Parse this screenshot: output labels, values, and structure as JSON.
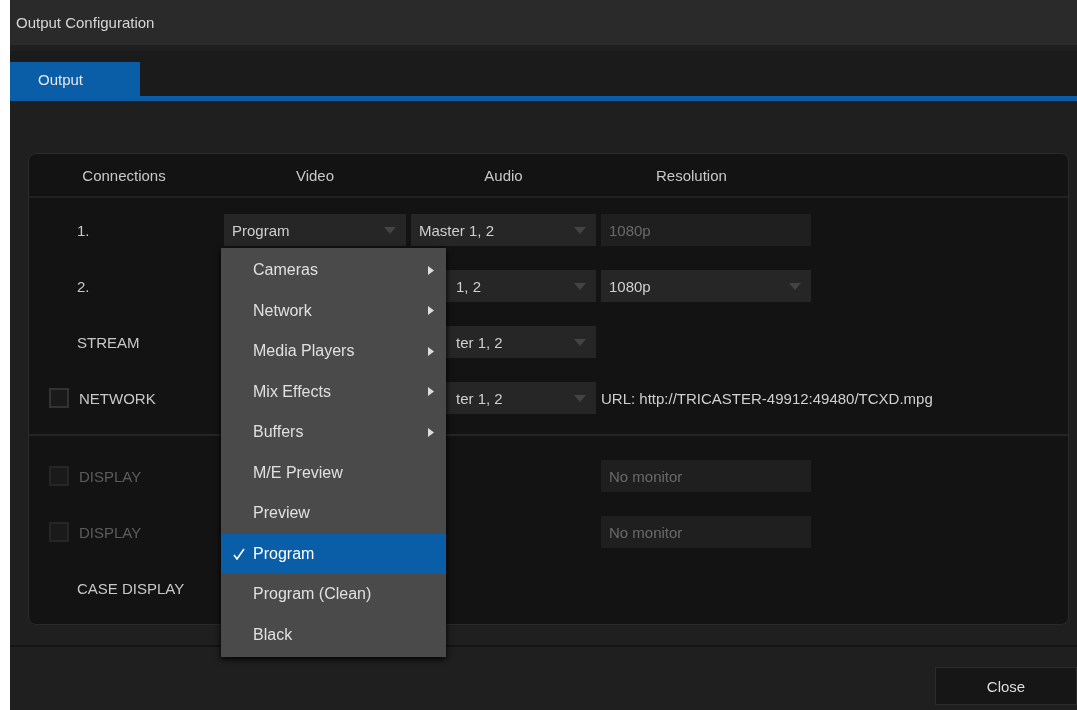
{
  "window": {
    "title": "Output Configuration"
  },
  "tabs": [
    {
      "label": "Output",
      "selected": true
    }
  ],
  "columns": [
    "Connections",
    "Video",
    "Audio",
    "Resolution"
  ],
  "sections": [
    {
      "rows": [
        {
          "label": "1.",
          "kind": "plain",
          "video": "Program",
          "audio": "Master 1, 2",
          "resolution": {
            "value": "1080p",
            "disabled": true
          }
        },
        {
          "label": "2.",
          "kind": "plain",
          "audio": "1, 2",
          "resolution": {
            "value": "1080p",
            "disabled": false
          }
        },
        {
          "label": "STREAM",
          "kind": "plain",
          "audio": "ter 1, 2"
        },
        {
          "label": "NETWORK",
          "kind": "checkbox",
          "checked": false,
          "disabled": false,
          "audio": "ter 1, 2",
          "url": "URL:  http://TRICASTER-49912:49480/TCXD.mpg"
        }
      ]
    },
    {
      "rows": [
        {
          "label": "DISPLAY",
          "kind": "checkbox",
          "checked": false,
          "disabled": true,
          "resolution": {
            "value": "No monitor",
            "disabled": true
          }
        },
        {
          "label": "DISPLAY",
          "kind": "checkbox",
          "checked": false,
          "disabled": true,
          "resolution": {
            "value": "No monitor",
            "disabled": true
          }
        },
        {
          "label": "CASE DISPLAY",
          "kind": "plain"
        }
      ]
    }
  ],
  "menu": {
    "items": [
      {
        "label": "Cameras",
        "submenu": true,
        "selected": false
      },
      {
        "label": "Network",
        "submenu": true,
        "selected": false
      },
      {
        "label": "Media Players",
        "submenu": true,
        "selected": false
      },
      {
        "label": "Mix Effects",
        "submenu": true,
        "selected": false
      },
      {
        "label": "Buffers",
        "submenu": true,
        "selected": false
      },
      {
        "label": "M/E Preview",
        "submenu": false,
        "selected": false
      },
      {
        "label": "Preview",
        "submenu": false,
        "selected": false
      },
      {
        "label": "Program",
        "submenu": false,
        "selected": true
      },
      {
        "label": "Program (Clean)",
        "submenu": false,
        "selected": false
      },
      {
        "label": "Black",
        "submenu": false,
        "selected": false
      }
    ]
  },
  "buttons": [
    "Close"
  ]
}
